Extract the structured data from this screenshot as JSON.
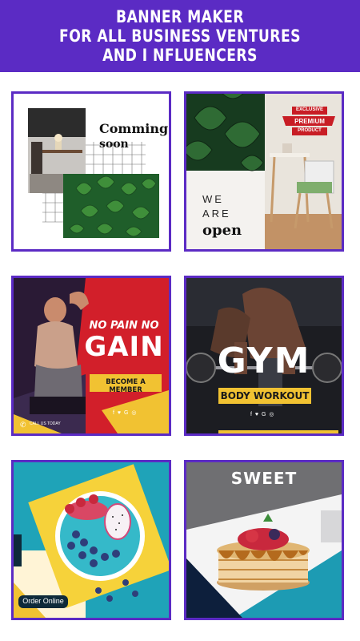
{
  "header": {
    "line1": "BANNER MAKER",
    "line2": "FOR ALL BUSINESS VENTURES",
    "line3": "AND I NFLUENCERS",
    "bg": "#5b2bc4"
  },
  "cards": {
    "coming": {
      "title_line1": "Comming",
      "title_line2": "soon"
    },
    "open": {
      "line1": "WE",
      "line2": "ARE",
      "line3": "open",
      "ribbon1": "EXCLUSIVE",
      "ribbon2": "PREMIUM",
      "ribbon3": "PRODUCT"
    },
    "gain": {
      "line1": "NO PAIN NO",
      "line2": "GAIN",
      "cta": "BECOME A MEMBER",
      "call": "CALL US TODAY",
      "social": "f ♥ G ◎"
    },
    "gym": {
      "title": "GYM",
      "subtitle": "BODY WORKOUT",
      "social": "f ♥ G ◎"
    },
    "bowl": {
      "cta": "Order Online"
    },
    "sweet": {
      "title": "SWEET"
    }
  }
}
